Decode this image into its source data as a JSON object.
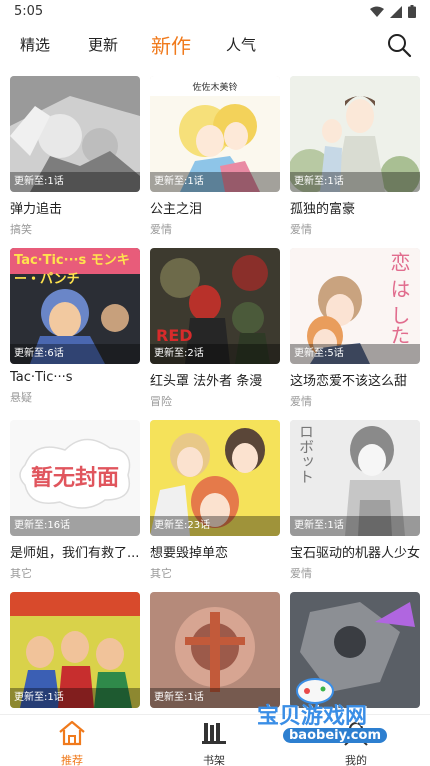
{
  "status": {
    "time": "5:05"
  },
  "tabs": [
    {
      "label": "精选"
    },
    {
      "label": "更新"
    },
    {
      "label": "新作",
      "active": true
    },
    {
      "label": "人气"
    }
  ],
  "accent_color": "#f07a1c",
  "comics": [
    {
      "title": "弹力追击",
      "genre": "搞笑",
      "update": "更新至:1话",
      "cover_text": ""
    },
    {
      "title": "公主之泪",
      "genre": "爱情",
      "update": "更新至:1话",
      "cover_text": "佐佐木美铃"
    },
    {
      "title": "孤独的富豪",
      "genre": "爱情",
      "update": "更新至:1话",
      "cover_text": ""
    },
    {
      "title": "Tac·Tic···s",
      "genre": "悬疑",
      "update": "更新至:6话",
      "cover_text": "Tac·Tic···s  モンキー・パンチ"
    },
    {
      "title": "红头罩 法外者 条漫",
      "genre": "冒险",
      "update": "更新至:2话",
      "cover_text": "RED"
    },
    {
      "title": "这场恋爱不该这么甜",
      "genre": "爱情",
      "update": "更新至:5话",
      "cover_text": "恋 は した"
    },
    {
      "title": "是师姐，我们有救了...",
      "genre": "其它",
      "update": "更新至:16话",
      "cover_text": "暂无封面"
    },
    {
      "title": "想要毁掉单恋",
      "genre": "其它",
      "update": "更新至:23话",
      "cover_text": ""
    },
    {
      "title": "宝石驱动的机器人少女",
      "genre": "爱情",
      "update": "更新至:1话",
      "cover_text": "ロボット"
    },
    {
      "title": "",
      "genre": "",
      "update": "更新至:1话",
      "cover_text": ""
    },
    {
      "title": "",
      "genre": "",
      "update": "更新至:1话",
      "cover_text": ""
    },
    {
      "title": "",
      "genre": "",
      "update": "",
      "cover_text": ""
    }
  ],
  "bottom_nav": [
    {
      "label": "推荐",
      "icon": "home-icon",
      "active": true
    },
    {
      "label": "书架",
      "icon": "bookshelf-icon"
    },
    {
      "label": "我的",
      "icon": "profile-icon"
    }
  ],
  "watermark": {
    "text": "宝贝游戏网",
    "url": "baobeiy.com"
  }
}
